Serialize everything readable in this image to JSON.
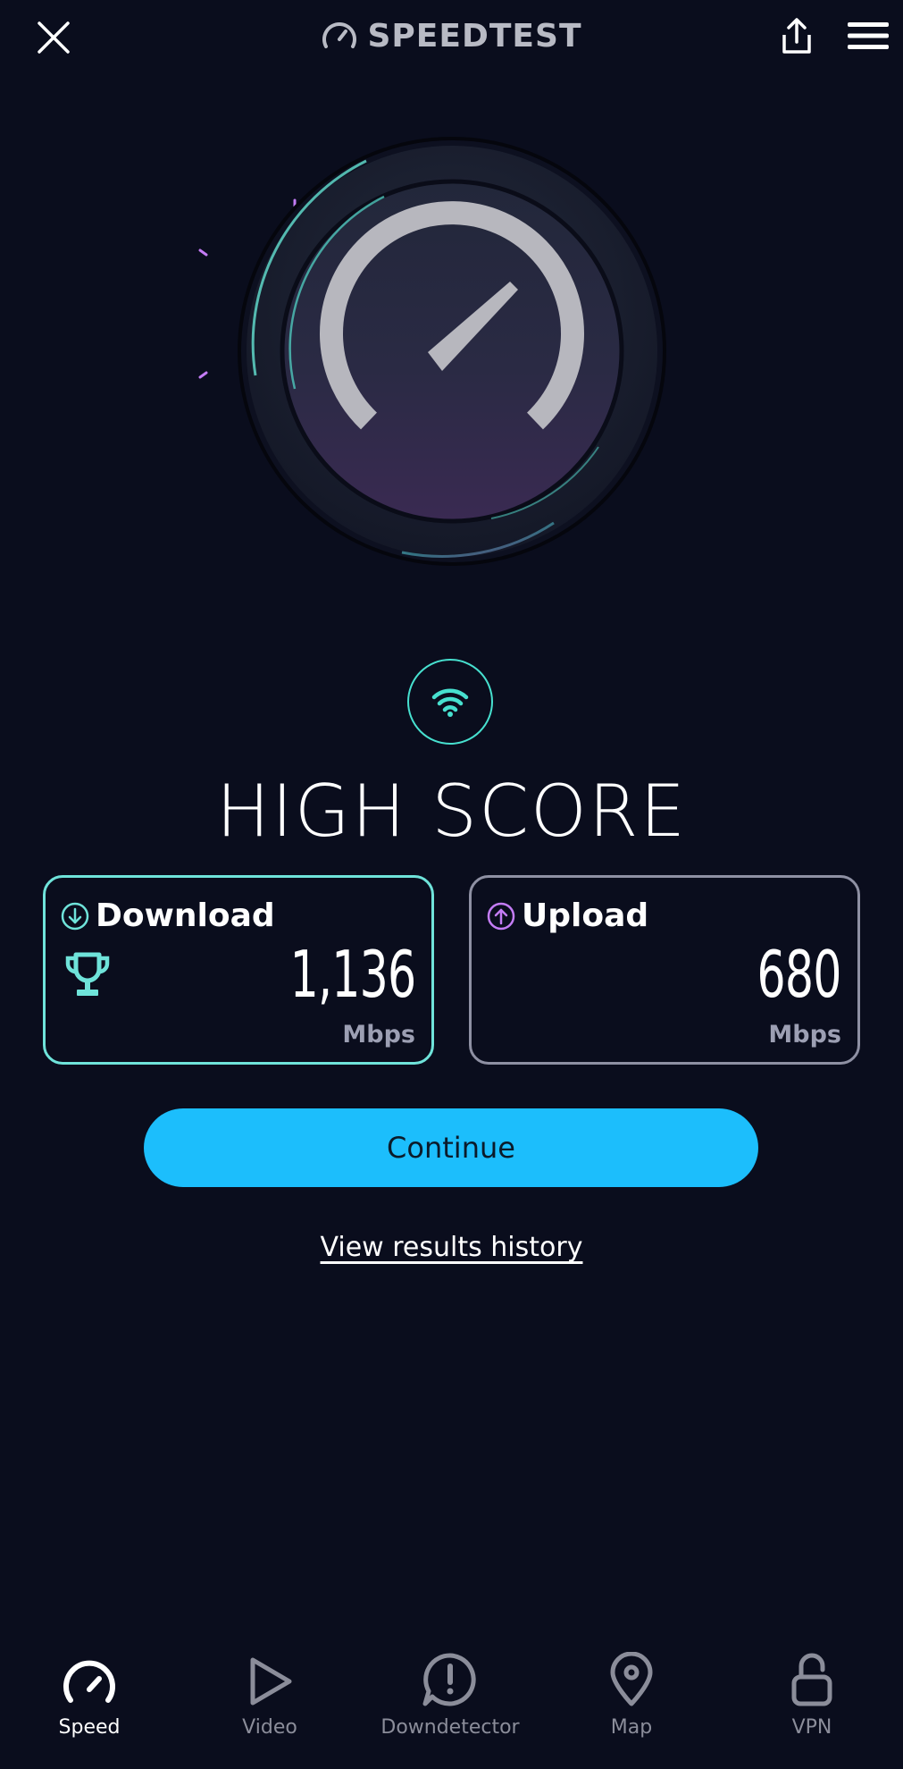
{
  "header": {
    "brand": "SPEEDTEST"
  },
  "result": {
    "title": "HIGH SCORE",
    "download": {
      "label": "Download",
      "value": "1,136",
      "unit": "Mbps"
    },
    "upload": {
      "label": "Upload",
      "value": "680",
      "unit": "Mbps"
    }
  },
  "actions": {
    "continue_label": "Continue",
    "history_label": "View results history"
  },
  "nav": {
    "items": [
      {
        "label": "Speed",
        "icon": "speedometer-icon",
        "active": true
      },
      {
        "label": "Video",
        "icon": "play-icon",
        "active": false
      },
      {
        "label": "Downdetector",
        "icon": "alert-bubble-icon",
        "active": false
      },
      {
        "label": "Map",
        "icon": "map-pin-icon",
        "active": false
      },
      {
        "label": "VPN",
        "icon": "unlock-icon",
        "active": false
      }
    ]
  },
  "colors": {
    "background": "#0a0d1d",
    "accent_teal": "#47e0cf",
    "accent_blue": "#1cbefc",
    "accent_purple": "#c47cf5",
    "muted": "#8b8d9a"
  }
}
